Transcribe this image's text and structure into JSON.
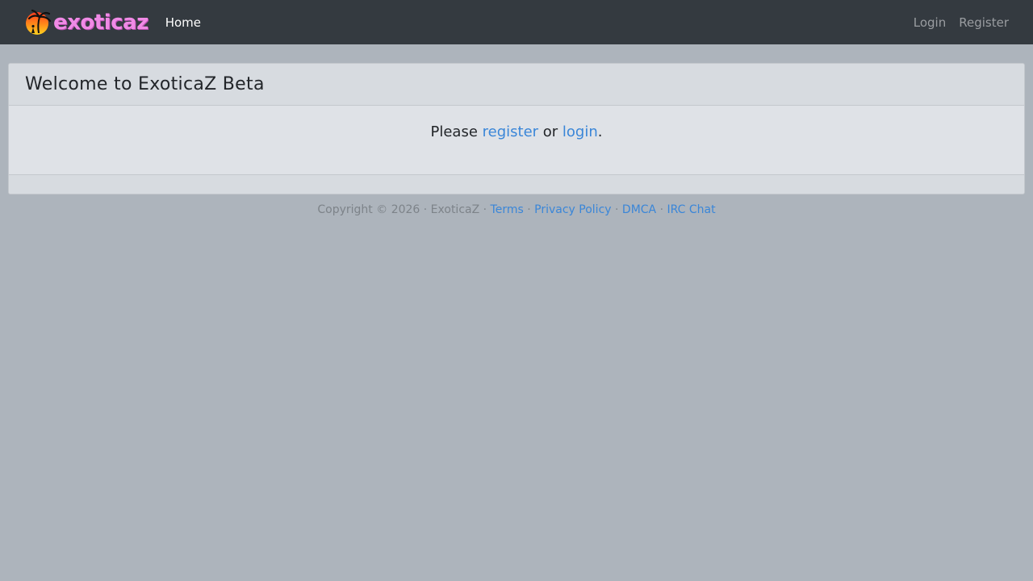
{
  "navbar": {
    "brand_text": "exoticaz",
    "home_label": "Home",
    "login_label": "Login",
    "register_label": "Register"
  },
  "card": {
    "title": "Welcome to ExoticaZ Beta",
    "prompt_before": "Please ",
    "register_link": "register",
    "prompt_middle": " or ",
    "login_link": "login",
    "prompt_after": "."
  },
  "footer": {
    "copyright": "Copyright © 2026 · ExoticaZ · ",
    "separator": "·",
    "links": {
      "terms": "Terms",
      "privacy": "Privacy Policy",
      "dmca": "DMCA",
      "irc": "IRC Chat"
    }
  },
  "colors": {
    "page_background": "#adb4bc",
    "navbar": "#343a40",
    "link": "#3a86d8",
    "brand_pink": "#f08ae6"
  },
  "icons": {
    "brand_logo": "sunset-palm-icon"
  }
}
